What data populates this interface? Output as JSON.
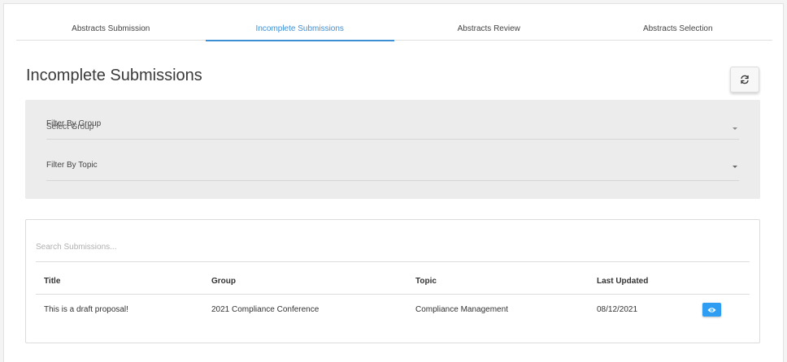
{
  "tabs": [
    {
      "label": "Abstracts Submission",
      "active": false
    },
    {
      "label": "Incomplete Submissions",
      "active": true
    },
    {
      "label": "Abstracts Review",
      "active": false
    },
    {
      "label": "Abstracts Selection",
      "active": false
    }
  ],
  "page_title": "Incomplete Submissions",
  "refresh_icon": "refresh-icon",
  "filters": {
    "group": {
      "label": "Filter By Group",
      "value": "Select Group"
    },
    "topic": {
      "label": "Filter By Topic",
      "value": ""
    }
  },
  "search": {
    "placeholder": "Search Submissions...",
    "value": ""
  },
  "table": {
    "columns": [
      "Title",
      "Group",
      "Topic",
      "Last Updated"
    ],
    "rows": [
      {
        "title": "This is a draft proposal!",
        "group": "2021 Compliance Conference",
        "topic": "Compliance Management",
        "last_updated": "08/12/2021",
        "action_icon": "eye-icon"
      }
    ]
  },
  "colors": {
    "accent": "#3d8fd6",
    "view_button": "#2f9df1",
    "filter_panel": "#ececec"
  }
}
